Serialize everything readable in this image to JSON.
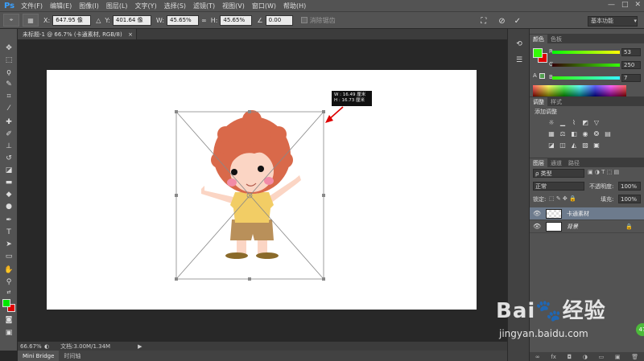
{
  "app": {
    "logo": "Ps"
  },
  "menu": [
    "文件(F)",
    "编辑(E)",
    "图像(I)",
    "图层(L)",
    "文字(Y)",
    "选择(S)",
    "滤镜(T)",
    "视图(V)",
    "窗口(W)",
    "帮助(H)"
  ],
  "window_controls": [
    "—",
    "□",
    "✕"
  ],
  "options": {
    "x_label": "X:",
    "x_value": "647.95 像",
    "y_label": "Y:",
    "y_value": "401.64 像",
    "w_label": "W:",
    "w_value": "45.65%",
    "link": "∞",
    "h_label": "H:",
    "h_value": "45.65%",
    "angle_value": "0.00",
    "smooth_label": "消除锯齿",
    "workspace": "基本功能"
  },
  "document": {
    "tab_title": "未标题-1 @ 66.7% (卡通素材, RGB/8)",
    "tab_close": "×",
    "tooltip_w": "W :  16.49 厘米",
    "tooltip_h": "H :  16.73 厘米"
  },
  "status": {
    "zoom": "66.67%",
    "doc_info": "文档:3.00M/1.34M"
  },
  "bottom_tabs": [
    "Mini Bridge",
    "时间轴"
  ],
  "color_panel": {
    "tabs": [
      "颜色",
      "色板"
    ],
    "r_label": "R",
    "r_value": "53",
    "g_label": "G",
    "g_value": "250",
    "b_label": "B",
    "b_value": "7",
    "fg_color": "#35fa07",
    "bg_color": "#e00000"
  },
  "adjust_panel": {
    "tabs": [
      "调整",
      "样式"
    ],
    "title": "添加调整"
  },
  "layers_panel": {
    "tabs": [
      "图层",
      "通道",
      "路径"
    ],
    "filter": "ρ 类型",
    "blend_mode": "正常",
    "opacity_label": "不透明度:",
    "opacity_value": "100%",
    "lock_label": "锁定:",
    "fill_label": "填充:",
    "fill_value": "100%",
    "layers": [
      {
        "name": "卡通素材",
        "selected": true
      },
      {
        "name": "背景",
        "locked": true
      }
    ],
    "footer": [
      "∞",
      "fx",
      "◘",
      "◑",
      "▭",
      "▣",
      "🗑"
    ]
  },
  "watermark": {
    "brand": "Bai🐾经验",
    "url": "jingyan.baidu.com",
    "badge": "47"
  }
}
